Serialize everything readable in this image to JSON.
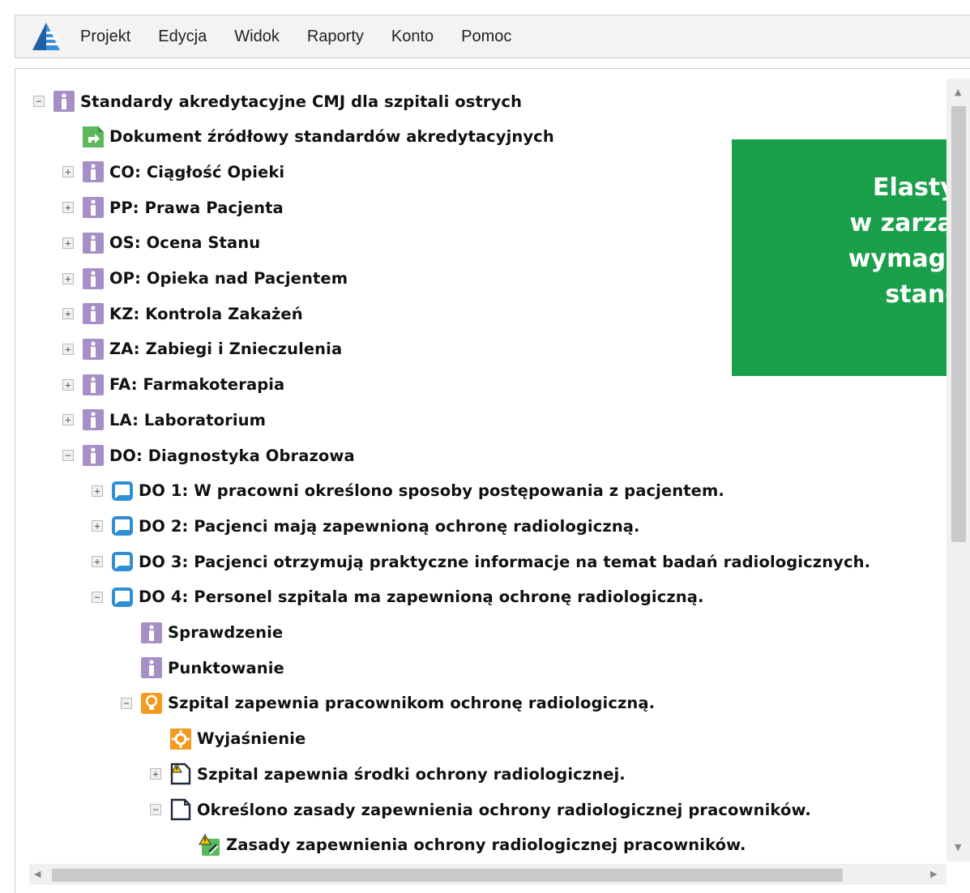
{
  "menu": {
    "items": [
      "Projekt",
      "Edycja",
      "Widok",
      "Raporty",
      "Konto",
      "Pomoc"
    ]
  },
  "tree": {
    "rows": [
      {
        "label": "Standardy akredytacyjne CMJ dla szpitali ostrych",
        "icon": "info-icon",
        "toggle": "−",
        "level": 0
      },
      {
        "label": "Dokument źródłowy standardów akredytacyjnych",
        "icon": "document-link-icon",
        "toggle": "",
        "level": 1
      },
      {
        "label": "CO: Ciągłość Opieki",
        "icon": "info-icon",
        "toggle": "+",
        "level": 1
      },
      {
        "label": "PP: Prawa Pacjenta",
        "icon": "info-icon",
        "toggle": "+",
        "level": 1
      },
      {
        "label": "OS: Ocena Stanu",
        "icon": "info-icon",
        "toggle": "+",
        "level": 1
      },
      {
        "label": "OP: Opieka nad Pacjentem",
        "icon": "info-icon",
        "toggle": "+",
        "level": 1
      },
      {
        "label": "KZ: Kontrola Zakażeń",
        "icon": "info-icon",
        "toggle": "+",
        "level": 1
      },
      {
        "label": "ZA: Zabiegi i Znieczulenia",
        "icon": "info-icon",
        "toggle": "+",
        "level": 1
      },
      {
        "label": "FA: Farmakoterapia",
        "icon": "info-icon",
        "toggle": "+",
        "level": 1
      },
      {
        "label": "LA: Laboratorium",
        "icon": "info-icon",
        "toggle": "+",
        "level": 1
      },
      {
        "label": "DO: Diagnostyka Obrazowa",
        "icon": "info-icon",
        "toggle": "−",
        "level": 1
      },
      {
        "label": "DO 1: W pracowni określono sposoby postępowania z pacjentem.",
        "icon": "speech-bubble-icon",
        "toggle": "+",
        "level": 2
      },
      {
        "label": "DO 2: Pacjenci mają zapewnioną ochronę radiologiczną.",
        "icon": "speech-bubble-icon",
        "toggle": "+",
        "level": 2
      },
      {
        "label": "DO 3: Pacjenci otrzymują praktyczne informacje na temat badań radiologicznych.",
        "icon": "speech-bubble-icon",
        "toggle": "+",
        "level": 2
      },
      {
        "label": "DO 4: Personel szpitala ma zapewnioną ochronę radiologiczną.",
        "icon": "speech-bubble-icon",
        "toggle": "−",
        "level": 2
      },
      {
        "label": "Sprawdzenie",
        "icon": "info-icon",
        "toggle": "",
        "level": 3
      },
      {
        "label": "Punktowanie",
        "icon": "info-icon",
        "toggle": "",
        "level": 3
      },
      {
        "label": "Szpital zapewnia pracownikom ochronę radiologiczną.",
        "icon": "lightbulb-icon",
        "toggle": "−",
        "level": 3
      },
      {
        "label": "Wyjaśnienie",
        "icon": "gear-icon",
        "toggle": "",
        "level": 4
      },
      {
        "label": "Szpital zapewnia środki ochrony radiologicznej.",
        "icon": "document-warning-icon",
        "toggle": "+",
        "level": 4
      },
      {
        "label": "Określono zasady zapewnienia ochrony radiologicznej pracowników.",
        "icon": "document-icon",
        "toggle": "−",
        "level": 4
      },
      {
        "label": "Zasady zapewnienia ochrony radiologicznej pracowników.",
        "icon": "warning-attachment-icon",
        "toggle": "",
        "level": 5
      }
    ]
  },
  "callout": {
    "lines": [
      "Elastyczno",
      "w zarządzan",
      "wymagania",
      "standardu"
    ]
  },
  "colors": {
    "callout_bg": "#1aa04a",
    "info_icon": "#a58fc6",
    "speech_icon": "#2f8fd6",
    "orange_icon": "#f39a1f",
    "green_icon": "#5cb85c"
  }
}
